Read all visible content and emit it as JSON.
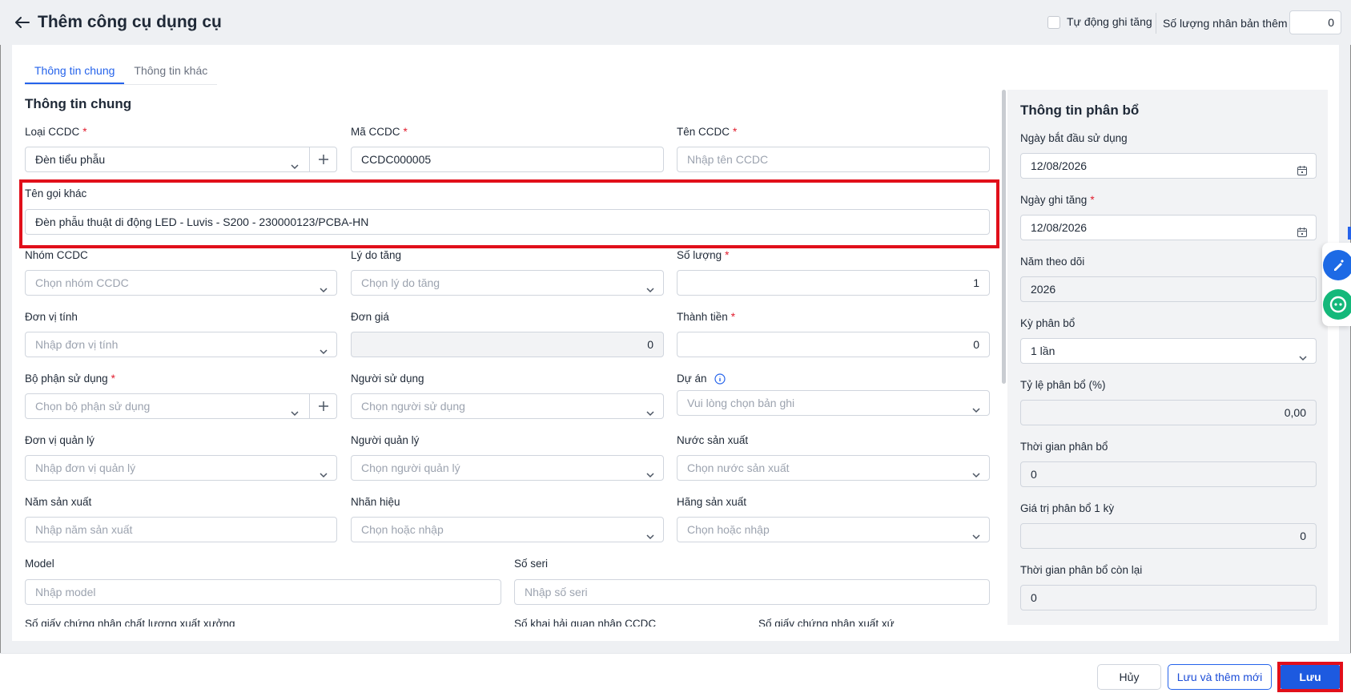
{
  "header": {
    "title": "Thêm công cụ dụng cụ",
    "auto_label": "Tự động ghi tăng",
    "qty_label": "Số lượng nhân bản thêm",
    "qty_value": "0"
  },
  "tabs": [
    {
      "label": "Thông tin chung"
    },
    {
      "label": "Thông tin khác"
    }
  ],
  "general": {
    "title": "Thông tin chung",
    "loai_label": "Loại CCDC",
    "loai_value": "Đèn tiểu phẫu",
    "ma_label": "Mã CCDC",
    "ma_value": "CCDC000005",
    "ten_label": "Tên CCDC",
    "ten_ph": "Nhập tên CCDC",
    "tengoi_label": "Tên gọi khác",
    "tengoi_value": "Đèn phẫu thuật di động LED - Luvis - S200 - 230000123/PCBA-HN",
    "nhom_label": "Nhóm CCDC",
    "nhom_ph": "Chọn nhóm CCDC",
    "lydo_label": "Lý do tăng",
    "lydo_ph": "Chọn lý do tăng",
    "soluong_label": "Số lượng",
    "soluong_value": "1",
    "dvt_label": "Đơn vị tính",
    "dvt_ph": "Nhập đơn vị tính",
    "dongia_label": "Đơn giá",
    "dongia_value": "0",
    "thanhtien_label": "Thành tiền",
    "thanhtien_value": "0",
    "bophan_label": "Bộ phận sử dụng",
    "bophan_ph": "Chọn bộ phận sử dụng",
    "nguoisd_label": "Người sử dụng",
    "nguoisd_ph": "Chọn người sử dụng",
    "duan_label": "Dự án",
    "duan_ph": "Vui lòng chọn bản ghi",
    "dvql_label": "Đơn vị quản lý",
    "dvql_ph": "Nhập đơn vị quản lý",
    "nguoiql_label": "Người quản lý",
    "nguoiql_ph": "Chọn người quản lý",
    "nuocsx_label": "Nước sản xuất",
    "nuocsx_ph": "Chọn nước sản xuất",
    "namsx_label": "Năm sản xuất",
    "namsx_ph": "Nhập năm sản xuất",
    "nhanhieu_label": "Nhãn hiệu",
    "nhanhieu_ph": "Chọn hoặc nhập",
    "hangsx_label": "Hãng sản xuất",
    "hangsx_ph": "Chọn hoặc nhập",
    "model_label": "Model",
    "model_ph": "Nhập model",
    "seri_label": "Số seri",
    "seri_ph": "Nhập số seri",
    "giaycn_label": "Số giấy chứng nhận chất lượng xuất xưởng",
    "khaihq_label": "Số khai hải quan nhập CCDC",
    "giayxx_label": "Số giấy chứng nhận xuất xứ"
  },
  "allocation": {
    "title": "Thông tin phân bổ",
    "start_label": "Ngày bắt đầu sử dụng",
    "start_value": "12/08/2026",
    "ghitang_label": "Ngày ghi tăng",
    "ghitang_value": "12/08/2026",
    "nam_label": "Năm theo dõi",
    "nam_value": "2026",
    "ky_label": "Kỳ phân bổ",
    "ky_value": "1 lần",
    "tyle_label": "Tỷ lệ phân bổ (%)",
    "tyle_value": "0,00",
    "tg_label": "Thời gian phân bổ",
    "tg_value": "0",
    "gt_label": "Giá trị phân bổ 1 kỳ",
    "gt_value": "0",
    "tgcl_label": "Thời gian phân bổ còn lại",
    "tgcl_value": "0"
  },
  "footer": {
    "cancel": "Hủy",
    "save_new": "Lưu và thêm mới",
    "save": "Lưu"
  },
  "colors": {
    "accent": "#1d5ae0",
    "required": "#e11d2e",
    "highlight": "#e10f1a"
  }
}
